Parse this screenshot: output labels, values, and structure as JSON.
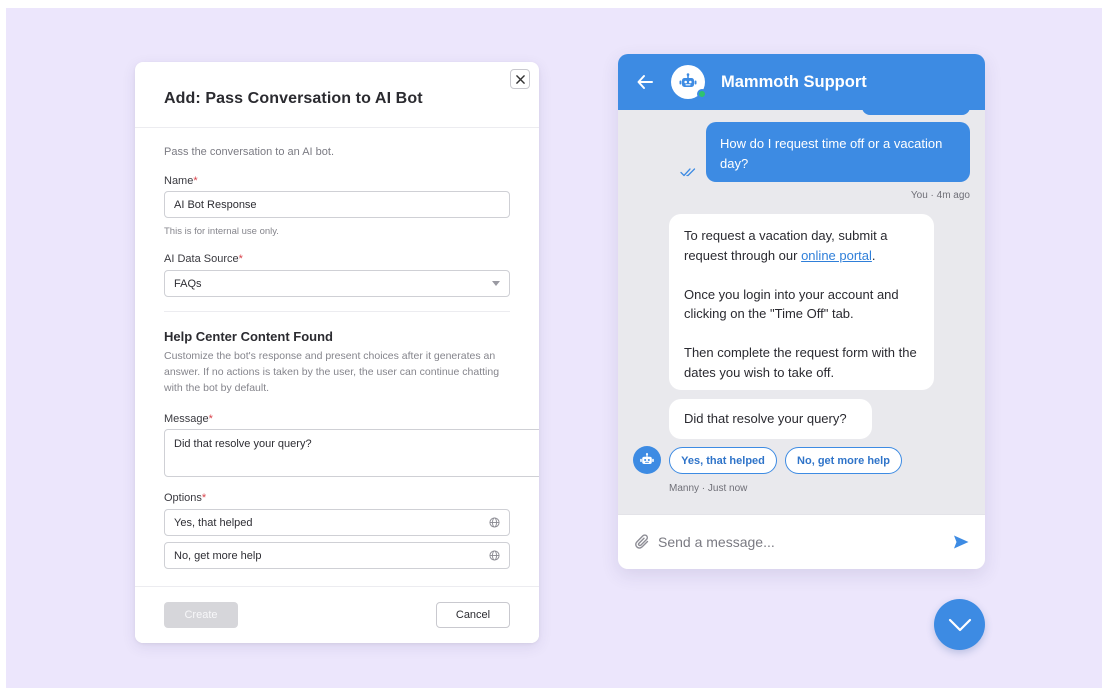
{
  "modal": {
    "title": "Add: Pass Conversation to AI Bot",
    "description": "Pass the conversation to an AI bot.",
    "name_label": "Name",
    "name_value": "AI Bot Response",
    "name_hint": "This is for internal use only.",
    "source_label": "AI Data Source",
    "source_value": "FAQs",
    "section_title": "Help Center Content Found",
    "section_description": "Customize the bot's response and present choices after it generates an answer. If no actions is taken by the user, the user can continue chatting with the bot by default.",
    "message_label": "Message",
    "message_value": "Did that resolve your query?",
    "options_label": "Options",
    "options": [
      "Yes, that helped",
      "No, get more help"
    ],
    "required_mark": "*",
    "create_label": "Create",
    "cancel_label": "Cancel"
  },
  "chat": {
    "title": "Mammoth Support",
    "user_message": "How do I request time off or a vacation day?",
    "user_meta": "You · 4m ago",
    "bot_reply": {
      "p1_before_link": "To request a vacation day, submit a request through our ",
      "link_text": "online portal",
      "p1_after_link": ".",
      "p2": "Once you login into your account and clicking on the \"Time Off\" tab.",
      "p3": "Then complete the request form with the dates you wish to take off."
    },
    "bot_question": "Did that resolve your query?",
    "quick_replies": [
      "Yes, that helped",
      "No, get more help"
    ],
    "bot_meta": "Manny · Just now",
    "composer_placeholder": "Send a message..."
  },
  "colors": {
    "accent": "#3d8be3",
    "backdrop": "#ece6fc",
    "required": "#d8434b",
    "online": "#2fc36e"
  },
  "icons": [
    "close-icon",
    "dropdown-caret-icon",
    "globe-icon",
    "back-arrow-icon",
    "bot-icon",
    "double-check-icon",
    "paperclip-icon",
    "send-icon",
    "chevron-down-icon"
  ]
}
